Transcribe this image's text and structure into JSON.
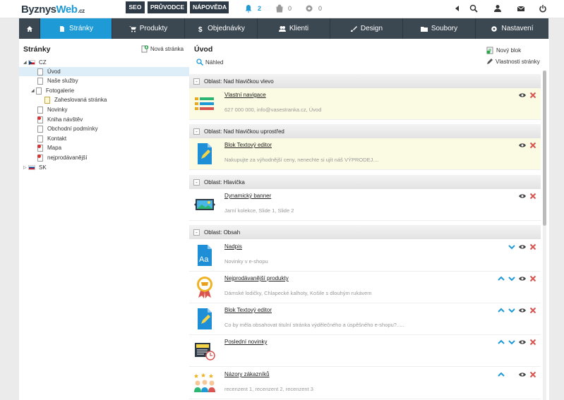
{
  "topbar": {
    "logo_main": "Byznys",
    "logo_web": "Web",
    "logo_tld": ".cz",
    "buttons": [
      "SEO",
      "PRŮVODCE",
      "NÁPOVĚDA"
    ],
    "notifications_count": "2",
    "orders_count": "0",
    "settings_count": "0"
  },
  "mainnav": {
    "items": [
      {
        "label": "Stránky",
        "icon": "file-icon"
      },
      {
        "label": "Produkty",
        "icon": "cart-icon"
      },
      {
        "label": "Objednávky",
        "icon": "dollar-icon"
      },
      {
        "label": "Klienti",
        "icon": "users-icon"
      },
      {
        "label": "Design",
        "icon": "brush-icon"
      },
      {
        "label": "Soubory",
        "icon": "folder-icon"
      },
      {
        "label": "Nastavení",
        "icon": "gear-icon"
      }
    ]
  },
  "left": {
    "title": "Stránky",
    "new_page": "Nová stránka",
    "tree": [
      {
        "label": "CZ",
        "type": "lang-cz"
      },
      {
        "label": "Úvod",
        "type": "page"
      },
      {
        "label": "Naše služby",
        "type": "page"
      },
      {
        "label": "Fotogalerie",
        "type": "page"
      },
      {
        "label": "Zaheslovaná stránka",
        "type": "page-locked"
      },
      {
        "label": "Novinky",
        "type": "page"
      },
      {
        "label": "Kniha návštěv",
        "type": "page-red"
      },
      {
        "label": "Obchodní podmínky",
        "type": "page"
      },
      {
        "label": "Kontakt",
        "type": "page"
      },
      {
        "label": "Mapa",
        "type": "page-red"
      },
      {
        "label": "nejprodávanější",
        "type": "page-red"
      },
      {
        "label": "SK",
        "type": "lang-sk"
      }
    ]
  },
  "right": {
    "title": "Úvod",
    "preview": "Náhled",
    "new_block": "Nový blok",
    "page_props": "Vlastnosti stránky",
    "areas": [
      {
        "header": "Oblast: Nad hlavičkou vlevo"
      },
      {
        "header": "Oblast: Nad hlavičkou uprostřed"
      },
      {
        "header": "Oblast: Hlavička"
      },
      {
        "header": "Oblast: Obsah"
      }
    ],
    "blocks": [
      {
        "title": "Vlastní navigace",
        "desc": "627 000 000, info@vasestranka.cz, Úvod",
        "icon": "navigation-icon"
      },
      {
        "title": "Blok Textový editor",
        "desc": "Nakupujte za výhodnější ceny, nenechte si ujít náš VÝPRODEJ....",
        "icon": "text-editor-icon"
      },
      {
        "title": "Dynamický banner",
        "desc": "Jarní kolekce, Slide 1, Slide 2",
        "icon": "banner-icon"
      },
      {
        "title": "Nadpis",
        "desc": "Novinky v e-shopu",
        "icon": "heading-icon"
      },
      {
        "title": "Nejprodávanější produkty",
        "desc": "Dámské lodičky, Chlapecké kalhoty, Košile s dlouhým rukávem",
        "icon": "bestseller-icon"
      },
      {
        "title": "Blok Textový editor",
        "desc": "Co by měla obsahovat titulní stránka výdělečného a úspěšného e-shopu?.....",
        "icon": "text-editor-icon"
      },
      {
        "title": "Poslední novinky",
        "desc": "",
        "icon": "news-icon"
      },
      {
        "title": "Názory zákazníků",
        "desc": "recenzent 1, recenzent 2, recenzent 3",
        "icon": "reviews-icon"
      }
    ]
  },
  "colors": {
    "accent": "#1e9ad6",
    "nav": "#3b4751",
    "delete": "#d9534f",
    "highlight": "#fbfbe3"
  }
}
